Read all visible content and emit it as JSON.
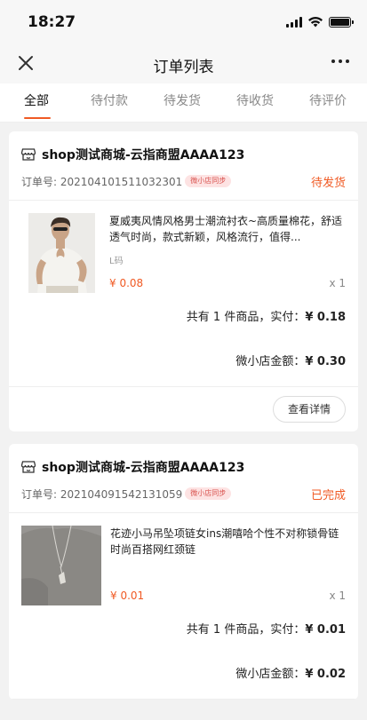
{
  "status_bar": {
    "time": "18:27"
  },
  "nav": {
    "title": "订单列表"
  },
  "tabs": [
    {
      "label": "全部",
      "active": true
    },
    {
      "label": "待付款",
      "active": false
    },
    {
      "label": "待发货",
      "active": false
    },
    {
      "label": "待收货",
      "active": false
    },
    {
      "label": "待评价",
      "active": false
    }
  ],
  "orders": [
    {
      "shop_name": "shop测试商城-云指商盟AAAA123",
      "order_label": "订单号: 20210410151103230​1",
      "badge": "微小店同步",
      "status": "待发货",
      "product": {
        "name": "夏威夷风情风格男士潮流衬衣~高质量棉花，舒适透气时尚，款式新颖，风格流行，值得...",
        "spec": "L码",
        "price": "¥ 0.08",
        "qty": "x 1"
      },
      "summary_prefix": "共有 1 件商品，实付：",
      "summary_amount": "¥ 0.18",
      "micro_label": "微小店金额：",
      "micro_amount": "¥ 0.30",
      "action_label": "查看详情"
    },
    {
      "shop_name": "shop测试商城-云指商盟AAAA123",
      "order_label": "订单号: 20210409154213105​9",
      "badge": "微小店同步",
      "status": "已完成",
      "product": {
        "name": "花迹小马吊坠项链女ins潮嘻哈个性不对称锁骨链时尚百搭网红颈链",
        "spec": "",
        "price": "¥ 0.01",
        "qty": "x 1"
      },
      "summary_prefix": "共有 1 件商品，实付：",
      "summary_amount": "¥ 0.01",
      "micro_label": "微小店金额：",
      "micro_amount": "¥ 0.02"
    }
  ],
  "colors": {
    "accent": "#f05a24",
    "badge_bg": "#fde3e3",
    "badge_text": "#d9534f"
  }
}
